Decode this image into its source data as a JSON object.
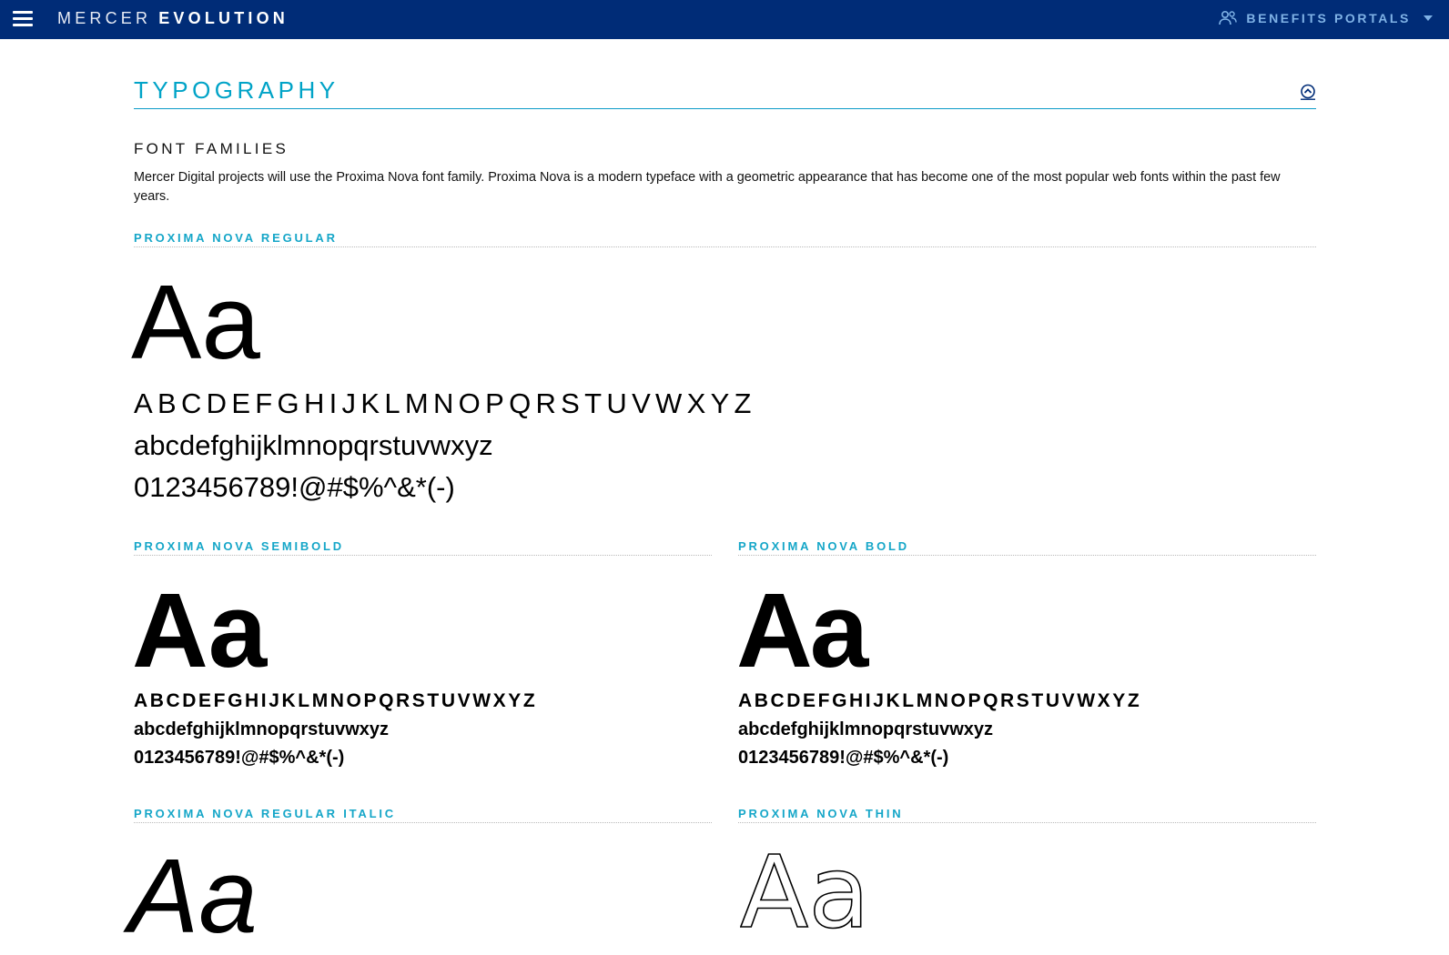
{
  "header": {
    "brand_light": "MERCER",
    "brand_bold": "EVOLUTION",
    "portals_label": "BENEFITS PORTALS"
  },
  "section": {
    "title": "TYPOGRAPHY",
    "subtitle": "FONT FAMILIES",
    "description": "Mercer Digital projects will use the Proxima Nova font family. Proxima Nova is a modern typeface with a geometric appearance that has become one of the most popular web fonts within the past few years."
  },
  "fonts": {
    "regular": {
      "label": "PROXIMA NOVA REGULAR",
      "sample": "Aa",
      "upper": "ABCDEFGHIJKLMNOPQRSTUVWXYZ",
      "lower": "abcdefghijklmnopqrstuvwxyz",
      "nums": "0123456789!@#$%^&*(-)"
    },
    "semibold": {
      "label": "PROXIMA NOVA SEMIBOLD",
      "sample": "Aa",
      "upper": "ABCDEFGHIJKLMNOPQRSTUVWXYZ",
      "lower": "abcdefghijklmnopqrstuvwxyz",
      "nums": "0123456789!@#$%^&*(-)"
    },
    "bold": {
      "label": "PROXIMA NOVA BOLD",
      "sample": "Aa",
      "upper": "ABCDEFGHIJKLMNOPQRSTUVWXYZ",
      "lower": "abcdefghijklmnopqrstuvwxyz",
      "nums": "0123456789!@#$%^&*(-)"
    },
    "italic": {
      "label": "PROXIMA NOVA REGULAR ITALIC",
      "sample": "Aa"
    },
    "thin": {
      "label": "PROXIMA NOVA THIN",
      "sample": "Aa"
    }
  },
  "colors": {
    "header_bg": "#002c77",
    "accent": "#00a3c7",
    "portals_text": "#7fb2e6"
  }
}
